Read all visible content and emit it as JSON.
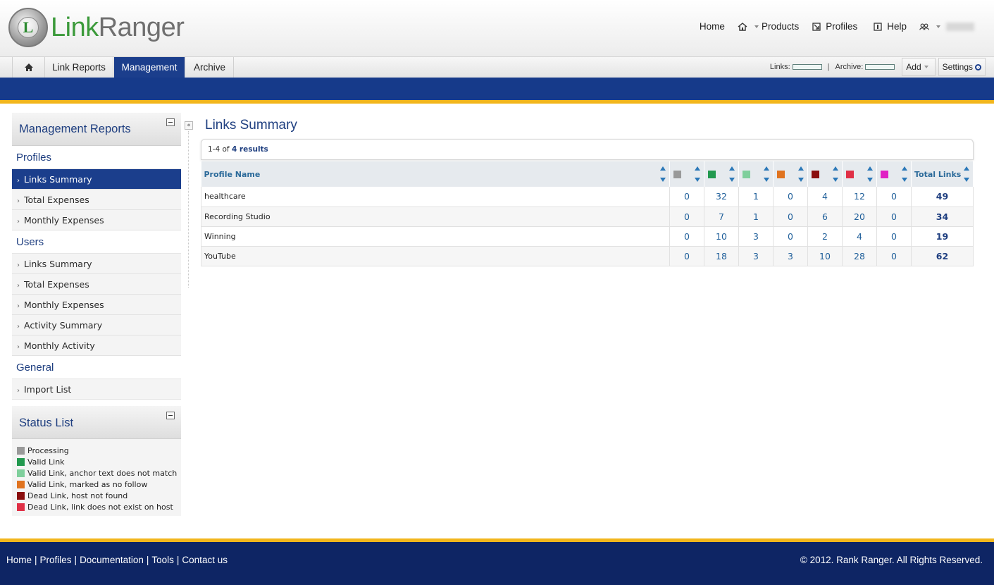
{
  "header": {
    "logo": {
      "mark": "L",
      "word_green": "Link",
      "word_gray": "Ranger"
    },
    "nav": {
      "home": "Home",
      "products": "Products",
      "profiles": "Profiles",
      "help": "Help"
    }
  },
  "tabs": {
    "home_icon": "home-icon",
    "items": [
      "Link Reports",
      "Management",
      "Archive"
    ],
    "active": "Management"
  },
  "toolbar": {
    "links_label": "Links:",
    "separator": "|",
    "archive_label": "Archive:",
    "add_label": "Add",
    "settings_label": "Settings"
  },
  "sidebar": {
    "management_title": "Management Reports",
    "sections": [
      {
        "label": "Profiles",
        "items": [
          "Links Summary",
          "Total Expenses",
          "Monthly Expenses"
        ]
      },
      {
        "label": "Users",
        "items": [
          "Links Summary",
          "Total Expenses",
          "Monthly Expenses",
          "Activity Summary",
          "Monthly Activity"
        ]
      },
      {
        "label": "General",
        "items": [
          "Import List"
        ]
      }
    ],
    "active_item": "Links Summary",
    "status_title": "Status List",
    "status_items": [
      {
        "label": "Processing",
        "color": "#999999"
      },
      {
        "label": "Valid Link",
        "color": "#22994f"
      },
      {
        "label": "Valid Link, anchor text does not match",
        "color": "#7fcf9c"
      },
      {
        "label": "Valid Link, marked as no follow",
        "color": "#e0731f"
      },
      {
        "label": "Dead Link, host not found",
        "color": "#8a0e0e"
      },
      {
        "label": "Dead Link, link does not exist on host",
        "color": "#e03046"
      }
    ]
  },
  "main": {
    "title": "Links Summary",
    "results_range": "1-4 of",
    "results_count": "4 results",
    "table": {
      "header_profile": "Profile Name",
      "header_total": "Total Links",
      "status_colors": [
        "#999999",
        "#22994f",
        "#7fcf9c",
        "#e0731f",
        "#8a0e0e",
        "#e03046",
        "#e020c4"
      ],
      "rows": [
        {
          "name": "healthcare",
          "values": [
            "0",
            "32",
            "1",
            "0",
            "4",
            "12",
            "0"
          ],
          "total": "49"
        },
        {
          "name": "Recording Studio",
          "values": [
            "0",
            "7",
            "1",
            "0",
            "6",
            "20",
            "0"
          ],
          "total": "34"
        },
        {
          "name": "Winning",
          "values": [
            "0",
            "10",
            "3",
            "0",
            "2",
            "4",
            "0"
          ],
          "total": "19"
        },
        {
          "name": "YouTube",
          "values": [
            "0",
            "18",
            "3",
            "3",
            "10",
            "28",
            "0"
          ],
          "total": "62"
        }
      ]
    }
  },
  "footer": {
    "links": [
      "Home",
      "Profiles",
      "Documentation",
      "Tools",
      "Contact us"
    ],
    "copyright": "© 2012. Rank Ranger. All Rights Reserved."
  }
}
